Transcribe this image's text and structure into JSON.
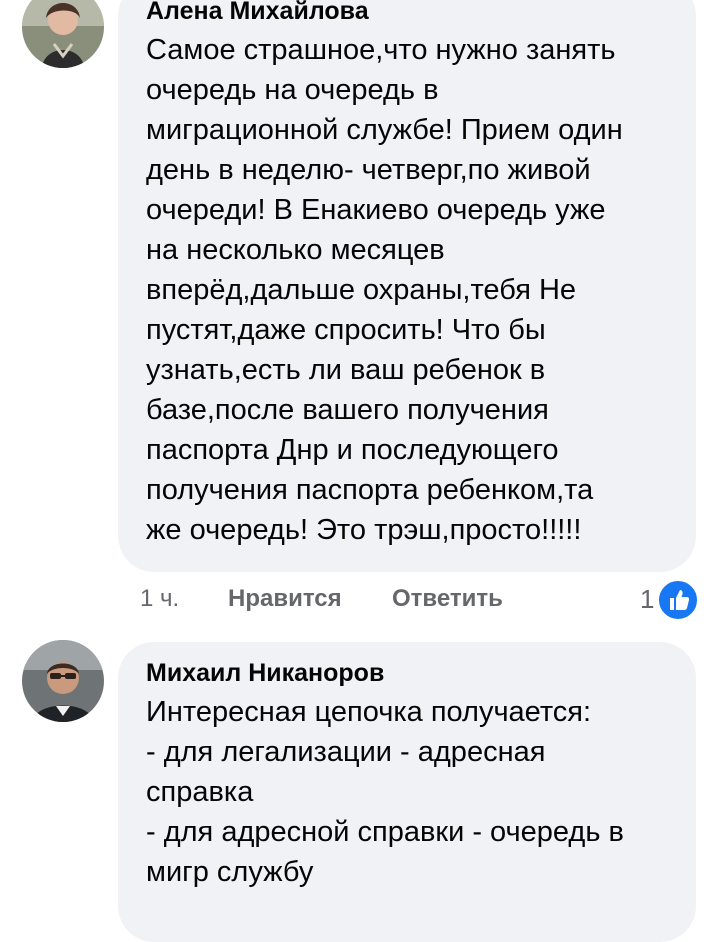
{
  "comments": [
    {
      "author": "Алена Михайлова",
      "lines": [
        "Самое страшное,что нужно занять",
        "очередь на очередь в",
        "миграционной службе! Прием один",
        "день в неделю- четверг,по живой",
        "очереди! В Енакиево очередь уже",
        "на несколько месяцев",
        "вперёд,дальше охраны,тебя Не",
        "пустят,даже спросить! Что бы",
        "узнать,есть ли ваш ребенок в",
        "базе,после вашего получения",
        "паспорта Днр и последующего",
        "получения паспорта ребенком,та",
        "же очередь! Это трэш,просто!!!!!"
      ],
      "time": "1 ч.",
      "like_label": "Нравится",
      "reply_label": "Ответить",
      "reaction_count": "1",
      "reaction_icon": "thumbs-up-icon",
      "reaction_color": "#1877f2"
    },
    {
      "author": "Михаил Никаноров",
      "lines": [
        "Интересная цепочка получается:",
        "- для легализации - адресная",
        "справка",
        "- для адресной справки - очередь в",
        "мигр службу"
      ]
    }
  ],
  "colors": {
    "bubble": "#f0f2f5",
    "meta_text": "#65676b",
    "body_text": "#050505"
  }
}
